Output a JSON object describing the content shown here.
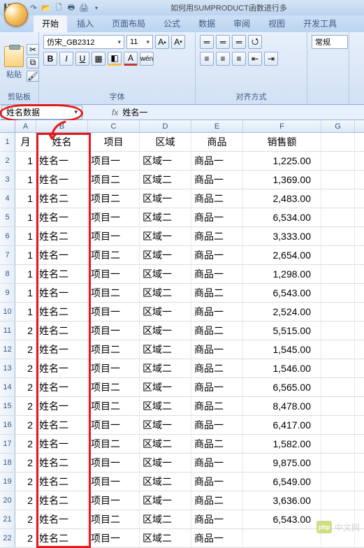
{
  "title": "如何用SUMPRODUCT函数进行多",
  "tabs": {
    "start": "开始",
    "insert": "插入",
    "layout": "页面布局",
    "formula": "公式",
    "data": "数据",
    "review": "审阅",
    "view": "视图",
    "dev": "开发工具"
  },
  "ribbon": {
    "paste_label": "粘贴",
    "clipboard_group": "剪贴板",
    "font_group": "字体",
    "align_group": "对齐方式",
    "font_name": "仿宋_GB2312",
    "font_size": "11",
    "style_label": "常规"
  },
  "namebox": "姓名数据",
  "formula_prefix": "fx",
  "formula_value": "姓名一",
  "columns": [
    "A",
    "B",
    "C",
    "D",
    "E",
    "F",
    "G"
  ],
  "headers": {
    "A": "月",
    "B": "姓名",
    "C": "项目",
    "D": "区域",
    "E": "商品",
    "F": "销售额"
  },
  "chart_data": {
    "type": "table",
    "columns": [
      "月",
      "姓名",
      "项目",
      "区域",
      "商品",
      "销售额"
    ],
    "rows": [
      [
        1,
        "姓名一",
        "项目一",
        "区域一",
        "商品一",
        "1,225.00"
      ],
      [
        1,
        "姓名一",
        "项目二",
        "区域二",
        "商品一",
        "1,369.00"
      ],
      [
        1,
        "姓名二",
        "项目二",
        "区域一",
        "商品二",
        "2,483.00"
      ],
      [
        1,
        "姓名一",
        "项目一",
        "区域二",
        "商品一",
        "6,534.00"
      ],
      [
        1,
        "姓名二",
        "项目一",
        "区域一",
        "商品二",
        "3,333.00"
      ],
      [
        1,
        "姓名一",
        "项目二",
        "区域一",
        "商品一",
        "2,654.00"
      ],
      [
        1,
        "姓名二",
        "项目一",
        "区域一",
        "商品一",
        "1,298.00"
      ],
      [
        1,
        "姓名一",
        "项目二",
        "区域二",
        "商品二",
        "6,543.00"
      ],
      [
        1,
        "姓名二",
        "项目一",
        "区域一",
        "商品一",
        "2,524.00"
      ],
      [
        2,
        "姓名二",
        "项目一",
        "区域一",
        "商品二",
        "5,515.00"
      ],
      [
        2,
        "姓名一",
        "项目二",
        "区域二",
        "商品一",
        "1,545.00"
      ],
      [
        2,
        "姓名一",
        "项目一",
        "区域二",
        "商品二",
        "1,546.00"
      ],
      [
        2,
        "姓名一",
        "项目二",
        "区域一",
        "商品一",
        "6,565.00"
      ],
      [
        2,
        "姓名一",
        "项目二",
        "区域二",
        "商品二",
        "8,478.00"
      ],
      [
        2,
        "姓名二",
        "项目一",
        "区域一",
        "商品一",
        "6,417.00"
      ],
      [
        2,
        "姓名一",
        "项目二",
        "区域二",
        "商品二",
        "1,582.00"
      ],
      [
        2,
        "姓名二",
        "项目一",
        "区域一",
        "商品一",
        "9,875.00"
      ],
      [
        2,
        "姓名二",
        "项目一",
        "区域二",
        "商品一",
        "6,549.00"
      ],
      [
        2,
        "姓名二",
        "项目一",
        "区域一",
        "商品二",
        "3,636.00"
      ],
      [
        2,
        "姓名一",
        "项目二",
        "区域二",
        "商品一",
        "6,543.00"
      ],
      [
        2,
        "姓名二",
        "项目一",
        "区域二",
        "商品一",
        ""
      ]
    ]
  },
  "watermark": {
    "badge": "php",
    "text": "中文网"
  }
}
